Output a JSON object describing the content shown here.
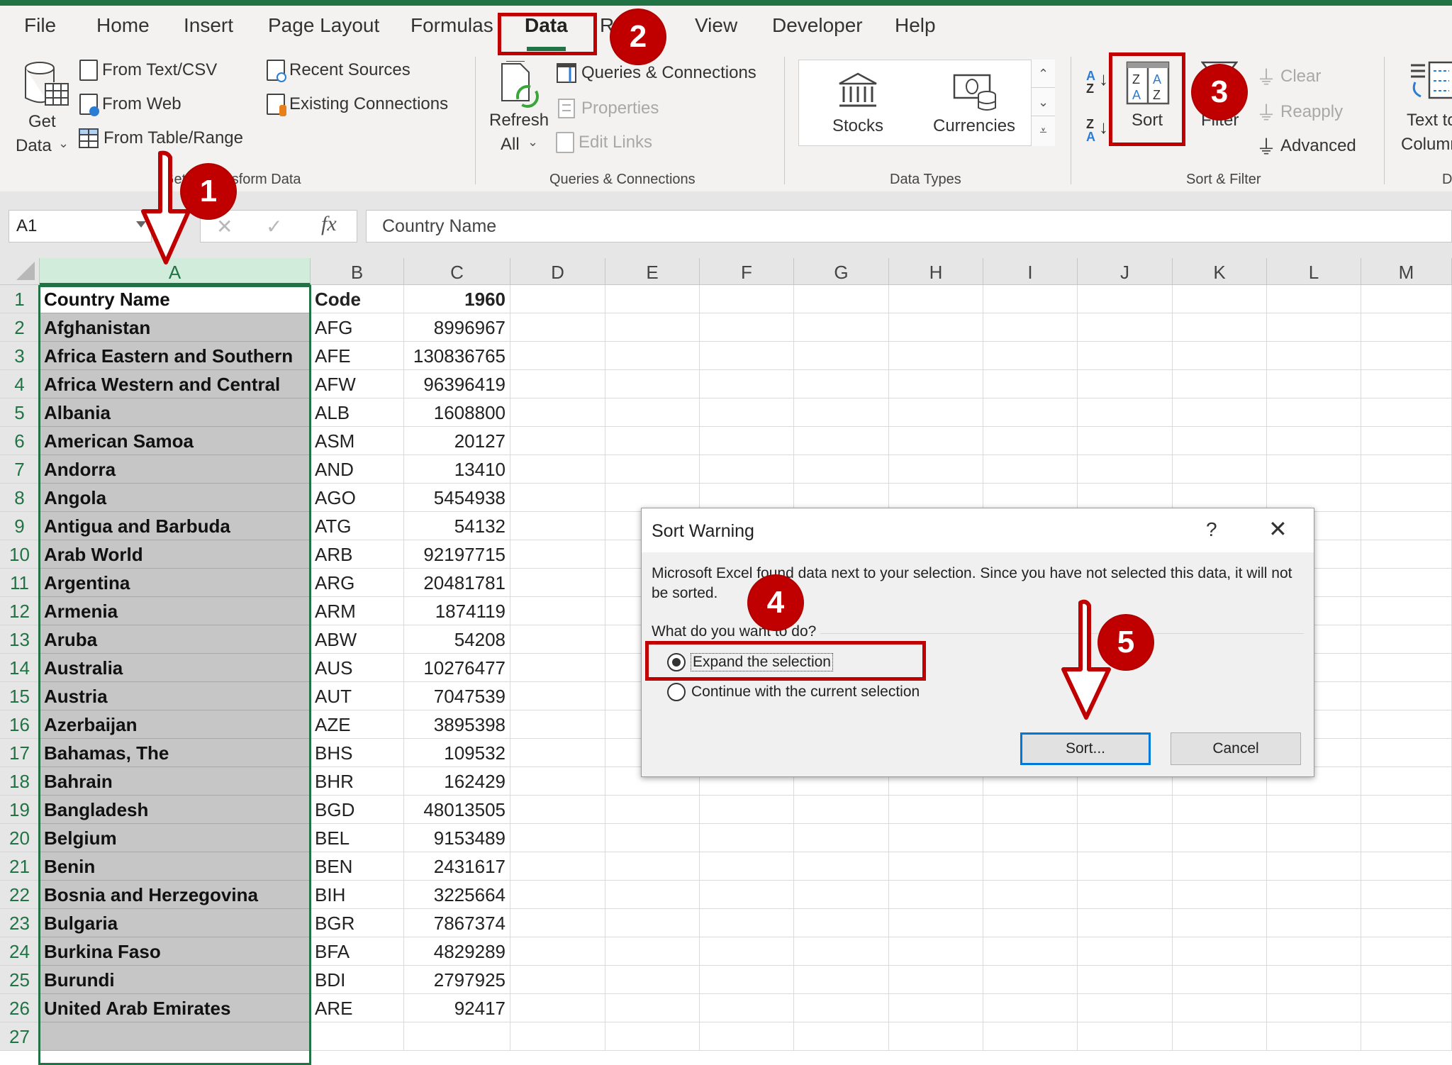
{
  "app": {
    "accent": "#217346",
    "annotation_color": "#c00000"
  },
  "tabs": [
    {
      "label": "File"
    },
    {
      "label": "Home"
    },
    {
      "label": "Insert"
    },
    {
      "label": "Page Layout"
    },
    {
      "label": "Formulas"
    },
    {
      "label": "Data",
      "active": true
    },
    {
      "label": "R"
    },
    {
      "label": "View"
    },
    {
      "label": "Developer"
    },
    {
      "label": "Help"
    }
  ],
  "ribbon": {
    "get_transform": {
      "get_data_line1": "Get",
      "get_data_line2": "Data",
      "from_text_csv": "From Text/CSV",
      "from_web": "From Web",
      "from_table_range": "From Table/Range",
      "recent_sources": "Recent Sources",
      "existing_connections": "Existing Connections",
      "group_label": "Get & Transform Data",
      "group_label_visible": "sform Data",
      "group_label_prefix": "Get"
    },
    "queries": {
      "refresh_line1": "Refresh",
      "refresh_line2": "All",
      "queries_connections": "Queries & Connections",
      "properties": "Properties",
      "edit_links": "Edit Links",
      "group_label": "Queries & Connections"
    },
    "data_types": {
      "stocks": "Stocks",
      "currencies": "Currencies",
      "group_label": "Data Types"
    },
    "sort_filter": {
      "sort": "Sort",
      "filter": "Filter",
      "clear": "Clear",
      "reapply": "Reapply",
      "advanced": "Advanced",
      "group_label": "Sort & Filter"
    },
    "data_tools": {
      "text_to_line1": "Text to",
      "text_to_line2": "Columns",
      "group_label": "D"
    }
  },
  "formula_bar": {
    "name_box": "A1",
    "cancel": "✕",
    "enter": "✓",
    "fx": "fx",
    "value": "Country Name"
  },
  "columns": [
    "A",
    "B",
    "C",
    "D",
    "E",
    "F",
    "G",
    "H",
    "I",
    "J",
    "K",
    "L",
    "M"
  ],
  "rows": [
    {
      "n": "1",
      "name": "Country Name",
      "code": "Code",
      "year": "1960"
    },
    {
      "n": "2",
      "name": "Afghanistan",
      "code": "AFG",
      "year": "8996967"
    },
    {
      "n": "3",
      "name": "Africa Eastern and Southern",
      "code": "AFE",
      "year": "130836765"
    },
    {
      "n": "4",
      "name": "Africa Western and Central",
      "code": "AFW",
      "year": "96396419"
    },
    {
      "n": "5",
      "name": "Albania",
      "code": "ALB",
      "year": "1608800"
    },
    {
      "n": "6",
      "name": "American Samoa",
      "code": "ASM",
      "year": "20127"
    },
    {
      "n": "7",
      "name": "Andorra",
      "code": "AND",
      "year": "13410"
    },
    {
      "n": "8",
      "name": "Angola",
      "code": "AGO",
      "year": "5454938"
    },
    {
      "n": "9",
      "name": "Antigua and Barbuda",
      "code": "ATG",
      "year": "54132"
    },
    {
      "n": "10",
      "name": "Arab World",
      "code": "ARB",
      "year": "92197715"
    },
    {
      "n": "11",
      "name": "Argentina",
      "code": "ARG",
      "year": "20481781"
    },
    {
      "n": "12",
      "name": "Armenia",
      "code": "ARM",
      "year": "1874119"
    },
    {
      "n": "13",
      "name": "Aruba",
      "code": "ABW",
      "year": "54208"
    },
    {
      "n": "14",
      "name": "Australia",
      "code": "AUS",
      "year": "10276477"
    },
    {
      "n": "15",
      "name": "Austria",
      "code": "AUT",
      "year": "7047539"
    },
    {
      "n": "16",
      "name": "Azerbaijan",
      "code": "AZE",
      "year": "3895398"
    },
    {
      "n": "17",
      "name": "Bahamas, The",
      "code": "BHS",
      "year": "109532"
    },
    {
      "n": "18",
      "name": "Bahrain",
      "code": "BHR",
      "year": "162429"
    },
    {
      "n": "19",
      "name": "Bangladesh",
      "code": "BGD",
      "year": "48013505"
    },
    {
      "n": "20",
      "name": "Belgium",
      "code": "BEL",
      "year": "9153489"
    },
    {
      "n": "21",
      "name": "Benin",
      "code": "BEN",
      "year": "2431617"
    },
    {
      "n": "22",
      "name": "Bosnia and Herzegovina",
      "code": "BIH",
      "year": "3225664"
    },
    {
      "n": "23",
      "name": "Bulgaria",
      "code": "BGR",
      "year": "7867374"
    },
    {
      "n": "24",
      "name": "Burkina Faso",
      "code": "BFA",
      "year": "4829289"
    },
    {
      "n": "25",
      "name": "Burundi",
      "code": "BDI",
      "year": "2797925"
    },
    {
      "n": "26",
      "name": "United Arab Emirates",
      "code": "ARE",
      "year": "92417"
    },
    {
      "n": "27",
      "name": "",
      "code": "",
      "year": ""
    }
  ],
  "dialog": {
    "title": "Sort Warning",
    "help": "?",
    "close": "✕",
    "message": "Microsoft Excel found data next to your selection.  Since you have not selected this data, it will not be sorted.",
    "question": "What do you want to do?",
    "option_expand": "Expand the selection",
    "option_continue": "Continue with the current selection",
    "selected_option": "expand",
    "sort_button": "Sort...",
    "cancel_button": "Cancel"
  },
  "annotations": [
    {
      "step": "1",
      "target": "column-A-header"
    },
    {
      "step": "2",
      "target": "tab-data"
    },
    {
      "step": "3",
      "target": "sort-button"
    },
    {
      "step": "4",
      "target": "expand-selection-radio"
    },
    {
      "step": "5",
      "target": "dialog-sort-button"
    }
  ]
}
